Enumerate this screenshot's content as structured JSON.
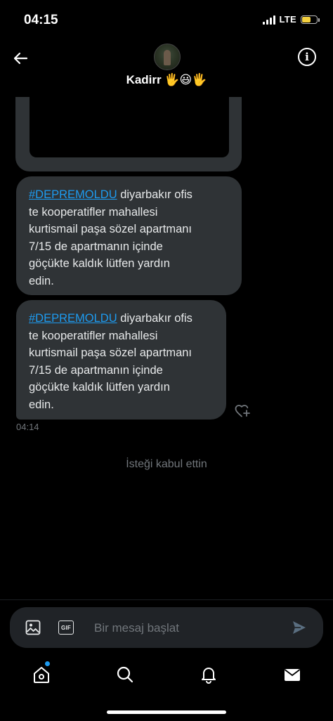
{
  "status_bar": {
    "time": "04:15",
    "network": "LTE",
    "battery_level": 0.6,
    "battery_color": "#f4d03f"
  },
  "header": {
    "contact_name": "Kadirr 🖐😃🖐",
    "back_icon": "arrow-left-icon",
    "info_icon": "info-icon"
  },
  "messages": [
    {
      "hashtag": "#DEPREMOLDU",
      "lines": [
        " diyarbakır ofis",
        "te kooperatifler mahallesi",
        "kurtismail paşa sözel apartmanı",
        "7/15 de apartmanın içinde",
        "göçükte kaldık lütfen yardın",
        "edin."
      ]
    },
    {
      "hashtag": "#DEPREMOLDU",
      "lines": [
        " diyarbakır ofis",
        "te kooperatifler mahallesi",
        "kurtismail paşa sözel apartmanı",
        "7/15 de apartmanın içinde",
        "göçükte kaldık lütfen yardın",
        "edin."
      ],
      "time": "04:14"
    }
  ],
  "system_message": "İsteği kabul ettin",
  "composer": {
    "placeholder": "Bir mesaj başlat",
    "gif_label": "GIF"
  },
  "tabs": [
    "home-icon",
    "search-icon",
    "bell-icon",
    "mail-icon"
  ],
  "colors": {
    "accent": "#1d9bf0",
    "bubble": "#2f3336",
    "muted": "#71767b"
  }
}
